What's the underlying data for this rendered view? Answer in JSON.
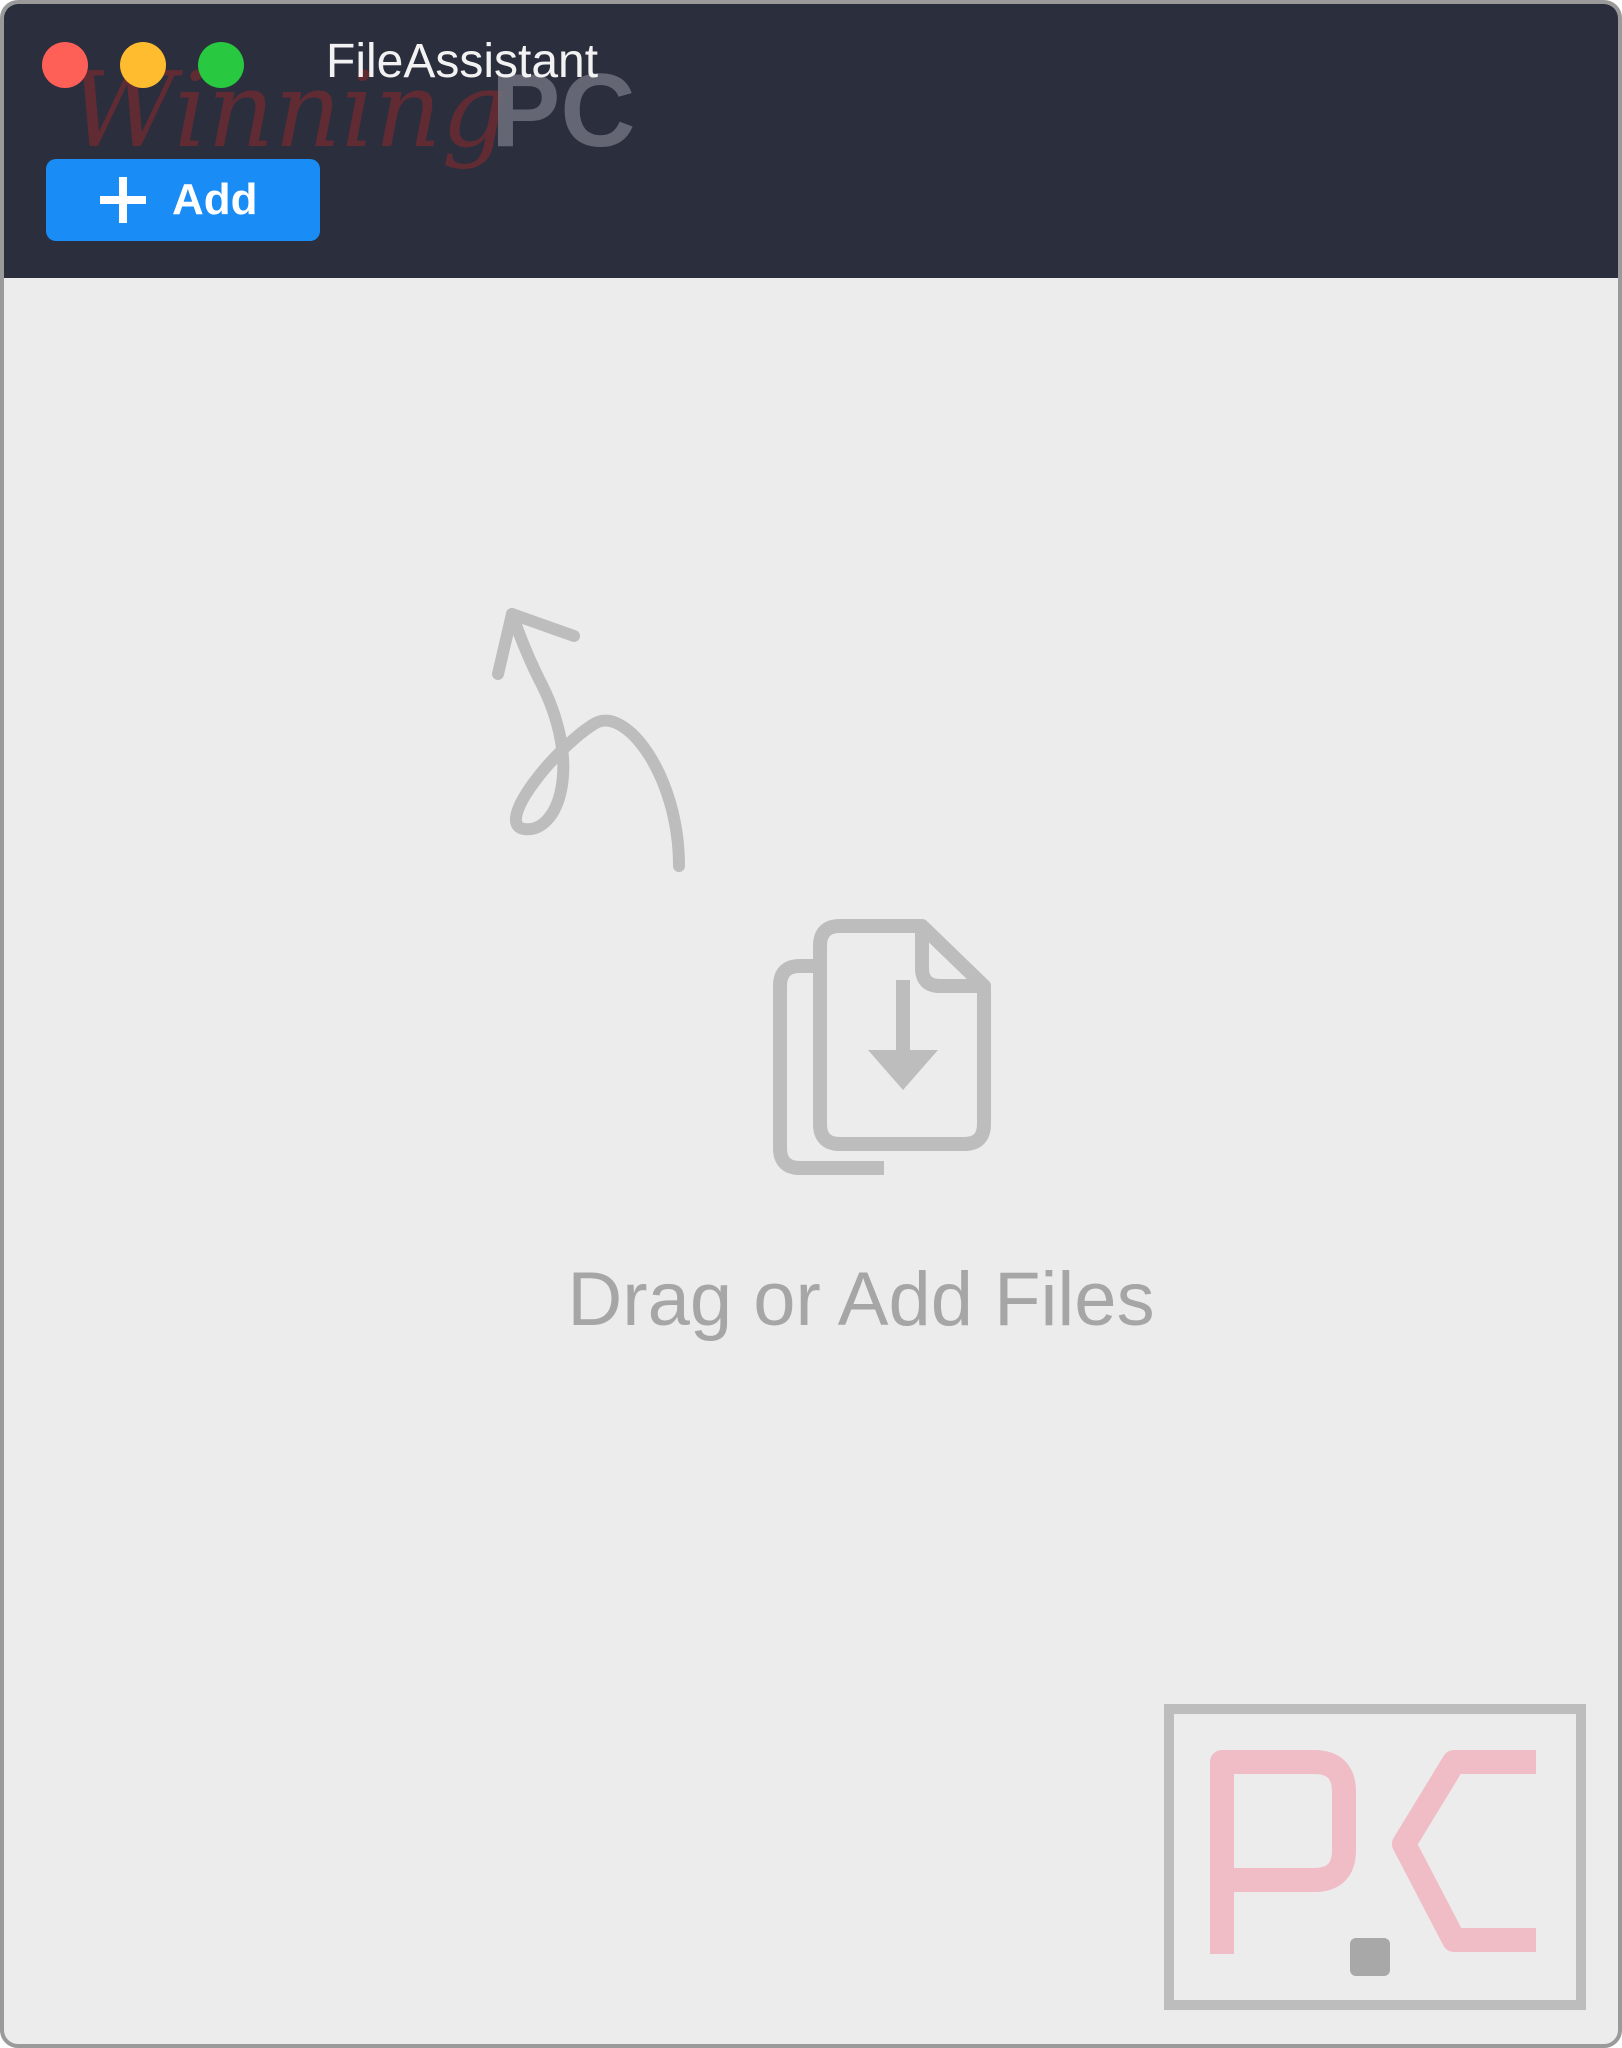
{
  "window": {
    "title": "FileAssistant",
    "traffic_lights": {
      "close_color": "#fe5f57",
      "minimize_color": "#febc2e",
      "zoom_color": "#28c840"
    }
  },
  "toolbar": {
    "add_label": "Add",
    "add_icon": "plus-icon",
    "accent_color": "#1a8cf5"
  },
  "drop_zone": {
    "message": "Drag or Add Files",
    "icon": "file-download-icon",
    "hint_icon": "curly-arrow-icon"
  },
  "watermarks": {
    "top": "WinningPC",
    "corner": "PC"
  }
}
